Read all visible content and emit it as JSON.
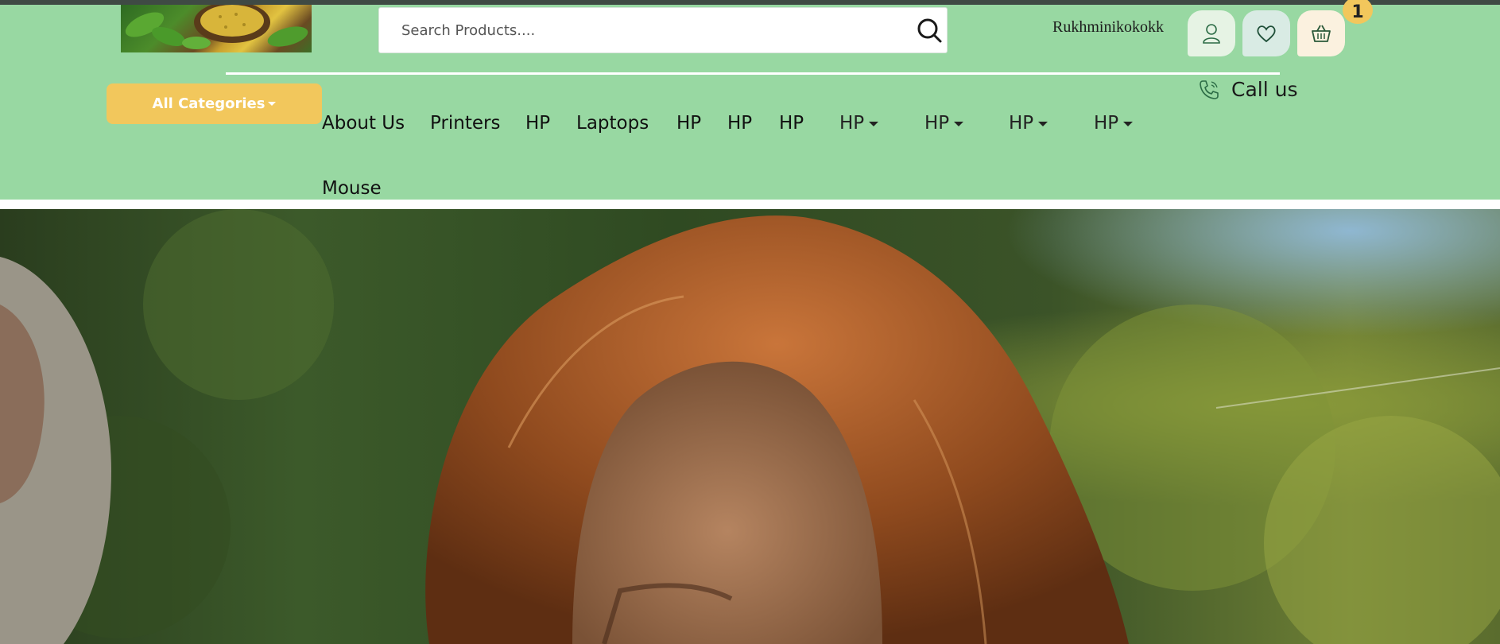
{
  "header": {
    "search": {
      "placeholder": "Search Products...."
    },
    "username": "Rukhminikokokk",
    "cart_count": "1",
    "call_label": "Call us",
    "all_categories_label": "All Categories",
    "colors": {
      "header_bg": "#98d8a2",
      "accent": "#f2c75c"
    }
  },
  "nav": {
    "items": [
      "About Us",
      "Printers",
      "HP",
      "Laptops",
      "HP",
      "HP",
      "HP"
    ],
    "dropdowns": [
      "HP",
      "HP",
      "HP",
      "HP"
    ],
    "second_row": [
      "Mouse"
    ]
  },
  "icons": [
    "search-icon",
    "user-icon",
    "heart-icon",
    "basket-icon",
    "phone-icon"
  ]
}
